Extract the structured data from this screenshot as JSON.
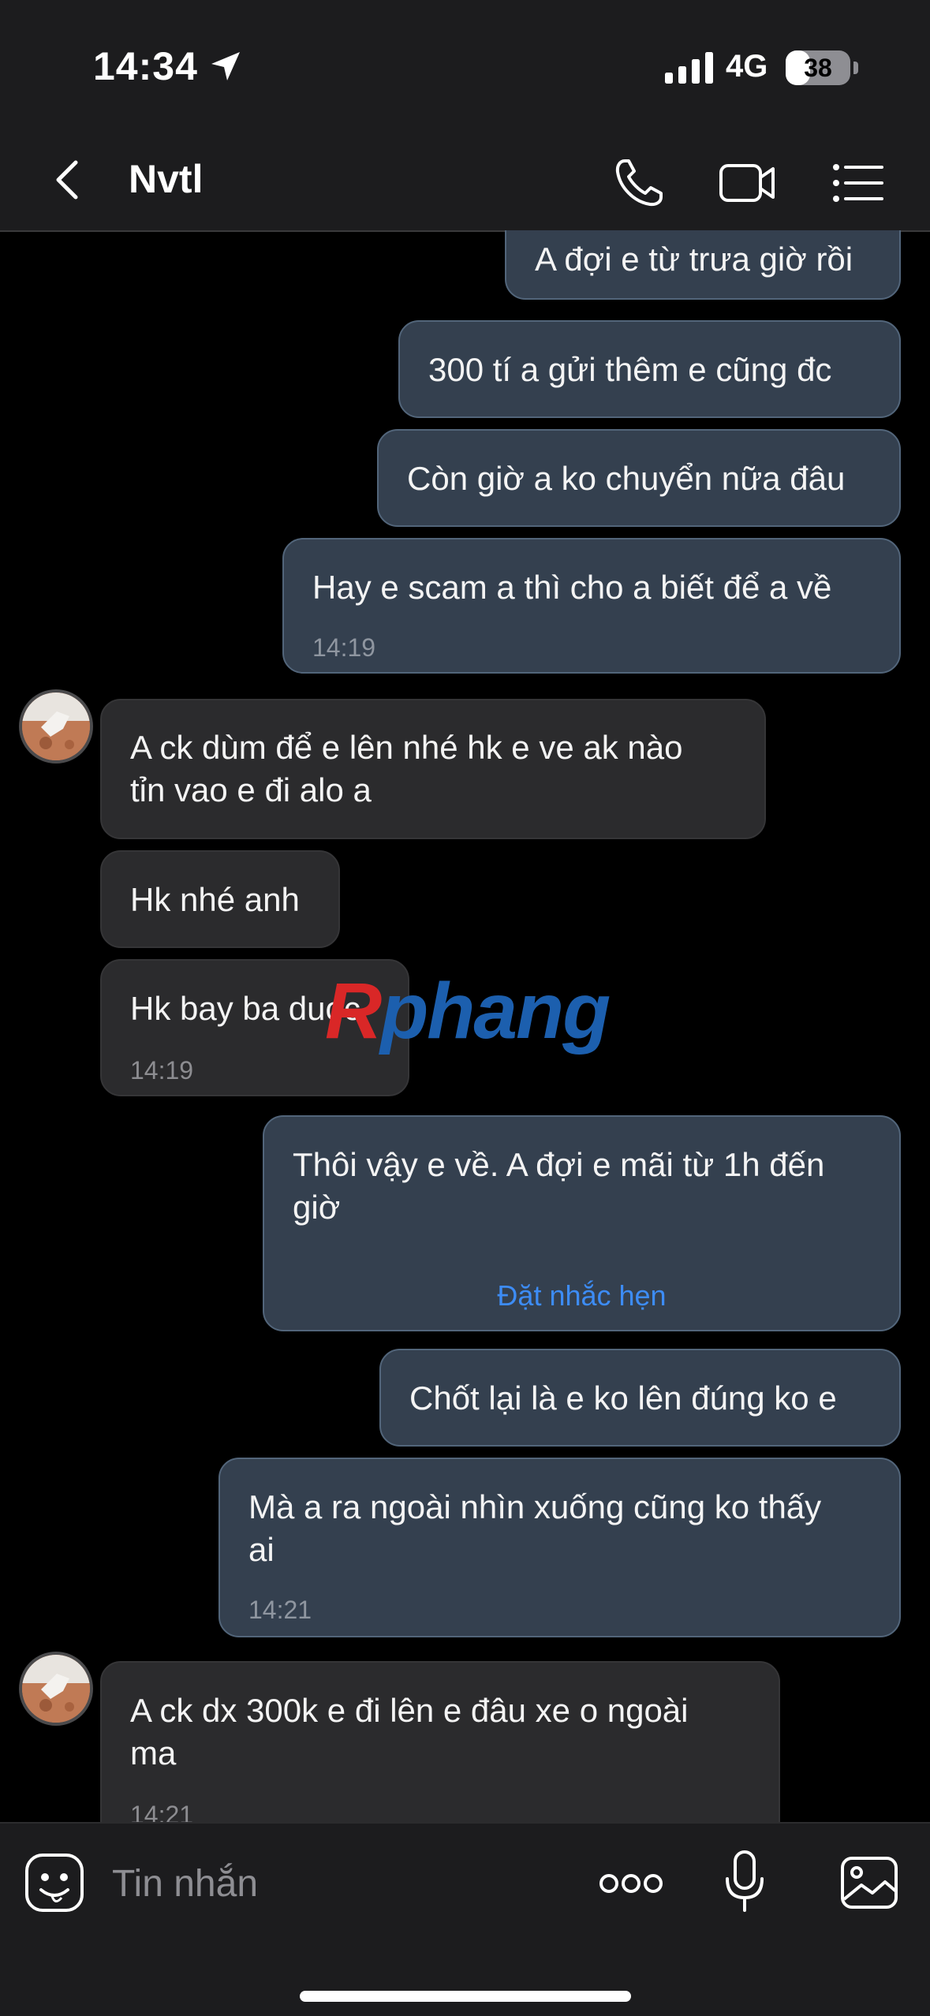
{
  "status_bar": {
    "time": "14:34",
    "network": "4G",
    "battery": "38",
    "battery_level": 0.38
  },
  "header": {
    "title": "Nvtl",
    "icons": [
      "chevron-left-icon",
      "phone-icon",
      "video-icon",
      "menu-list-icon"
    ]
  },
  "messages": [
    {
      "side": "out",
      "text": "A đợi e từ trưa giờ rồi"
    },
    {
      "side": "out",
      "text": "300 tí a gửi thêm e cũng đc"
    },
    {
      "side": "out",
      "text": "Còn giờ a ko chuyển nữa đâu"
    },
    {
      "side": "out",
      "text": "Hay e scam a thì cho a biết để a về",
      "time": "14:19"
    },
    {
      "side": "in",
      "text": "A ck dùm để e lên nhé hk e ve ak nào\ntỉn vao e đi alo a"
    },
    {
      "side": "in",
      "text": "Hk nhé anh"
    },
    {
      "side": "in",
      "text": "Hk bay ba duoc",
      "time": "14:19"
    },
    {
      "side": "out",
      "text": "Thôi vậy e về. A đợi e mãi từ 1h đến\ngiờ",
      "action": "Đặt nhắc hẹn"
    },
    {
      "side": "out",
      "text": "Chốt lại là e ko lên đúng ko e"
    },
    {
      "side": "out",
      "text": "Mà a ra ngoài nhìn xuống cũng ko thấy\nai",
      "time": "14:21"
    },
    {
      "side": "in",
      "text": "A ck dx 300k e đi lên e đâu xe o ngoài\nma",
      "time": "14:21"
    }
  ],
  "watermark": {
    "part1": "R",
    "part2": "phang"
  },
  "input_bar": {
    "placeholder": "Tin nhắn",
    "icons": [
      "sticker-icon",
      "more-icon",
      "microphone-icon",
      "image-icon"
    ]
  },
  "colors": {
    "outgoing_bubble": "#34404f",
    "incoming_bubble": "#2b2b2d",
    "link": "#3d8cf5",
    "bar_background": "#1c1c1e"
  }
}
